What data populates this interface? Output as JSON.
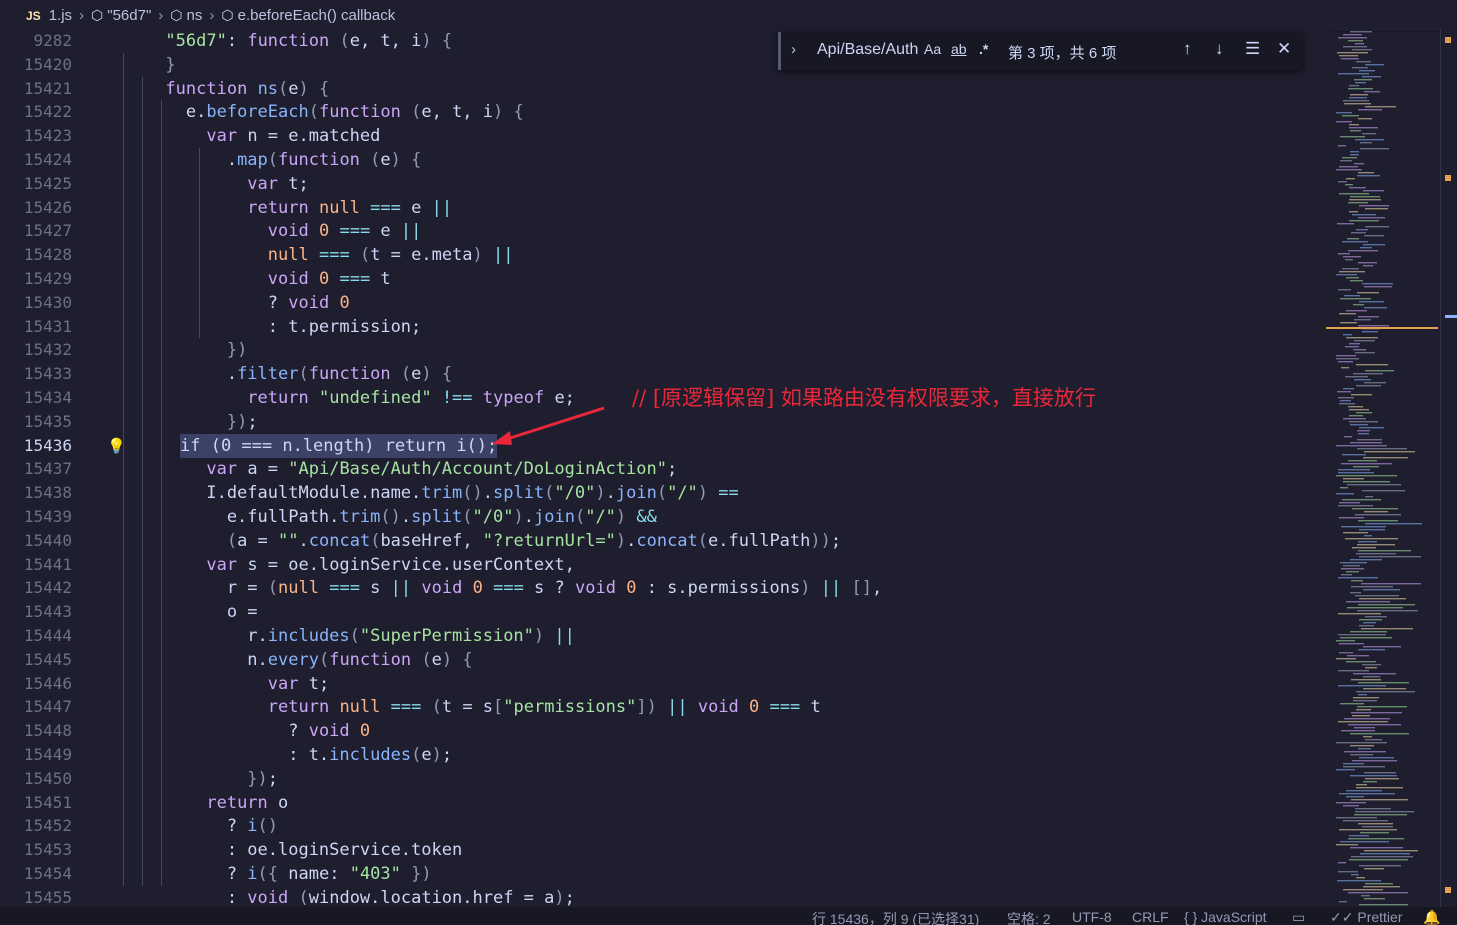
{
  "breadcrumb": {
    "lang_badge": "JS",
    "file": "1.js",
    "items": [
      "\"56d7\"",
      "ns",
      "e.beforeEach() callback"
    ]
  },
  "find_widget": {
    "query": "Api/Base/Auth",
    "match_case_label": "Aa",
    "whole_word_label": "ab",
    "regex_label": ".*",
    "result_text": "第 3 项，共 6 项"
  },
  "annotation": {
    "text": "// [原逻辑保留] 如果路由没有权限要求，直接放行",
    "color": "#e8283a"
  },
  "editor": {
    "current_line": "15436",
    "lines": [
      {
        "n": "9282",
        "sticky": true
      },
      {
        "n": "15420"
      },
      {
        "n": "15421"
      },
      {
        "n": "15422"
      },
      {
        "n": "15423"
      },
      {
        "n": "15424"
      },
      {
        "n": "15425"
      },
      {
        "n": "15426"
      },
      {
        "n": "15427"
      },
      {
        "n": "15428"
      },
      {
        "n": "15429"
      },
      {
        "n": "15430"
      },
      {
        "n": "15431"
      },
      {
        "n": "15432"
      },
      {
        "n": "15433"
      },
      {
        "n": "15434"
      },
      {
        "n": "15435"
      },
      {
        "n": "15436"
      },
      {
        "n": "15437"
      },
      {
        "n": "15438"
      },
      {
        "n": "15439"
      },
      {
        "n": "15440"
      },
      {
        "n": "15441"
      },
      {
        "n": "15442"
      },
      {
        "n": "15443"
      },
      {
        "n": "15444"
      },
      {
        "n": "15445"
      },
      {
        "n": "15446"
      },
      {
        "n": "15447"
      },
      {
        "n": "15448"
      },
      {
        "n": "15449"
      },
      {
        "n": "15450"
      },
      {
        "n": "15451"
      },
      {
        "n": "15452"
      },
      {
        "n": "15453"
      },
      {
        "n": "15454"
      },
      {
        "n": "15455"
      }
    ],
    "code": [
      [
        [
          "      ",
          ""
        ],
        [
          "\"56d7\"",
          "s"
        ],
        [
          ": ",
          ""
        ],
        [
          "function",
          "k"
        ],
        [
          " (e, t, i) ",
          ""
        ],
        [
          "{",
          "p"
        ]
      ],
      [
        [
          "      ",
          ""
        ],
        [
          "}",
          "f"
        ]
      ],
      [
        [
          "      ",
          ""
        ],
        [
          "function",
          "k"
        ],
        [
          " ",
          ""
        ],
        [
          "ns",
          "f"
        ],
        [
          "(e) ",
          ""
        ],
        [
          "{",
          "p"
        ]
      ],
      [
        [
          "        e.",
          ""
        ],
        [
          "beforeEach",
          "f"
        ],
        [
          "(",
          ""
        ],
        [
          "function",
          "k"
        ],
        [
          " (e, t, i) ",
          ""
        ],
        [
          "{",
          "p"
        ]
      ]
    ],
    "code_text": [
      "      \"56d7\": function (e, t, i) {",
      "      }",
      "      function ns(e) {",
      "        e.beforeEach(function (e, t, i) {",
      "          var n = e.matched",
      "            .map(function (e) {",
      "              var t;",
      "              return null === e ||",
      "                void 0 === e ||",
      "                null === (t = e.meta) ||",
      "                void 0 === t",
      "                ? void 0",
      "                : t.permission;",
      "            })",
      "            .filter(function (e) {",
      "              return \"undefined\" !== typeof e;",
      "            });",
      "          if (0 === n.length) return i();",
      "          var a = \"Api/Base/Auth/Account/DoLoginAction\";",
      "          I.defaultModule.name.trim().split(\"/0\").join(\"/\") ==",
      "            e.fullPath.trim().split(\"/0\").join(\"/\") &&",
      "            (a = \"\".concat(baseHref, \"?returnUrl=\").concat(e.fullPath));",
      "          var s = oe.loginService.userContext,",
      "            r = (null === s || void 0 === s ? void 0 : s.permissions) || [],",
      "            o =",
      "              r.includes(\"SuperPermission\") ||",
      "              n.every(function (e) {",
      "                var t;",
      "                return null === (t = s[\"permissions\"]) || void 0 === t",
      "                  ? void 0",
      "                  : t.includes(e);",
      "              });",
      "          return o",
      "            ? i()",
      "            : oe.loginService.token",
      "            ? i({ name: \"403\" })",
      "            : void (window.location.href = a);"
    ]
  },
  "status_bar": {
    "position": "行 15436，列 9 (已选择31)",
    "indent": "空格: 2",
    "encoding": "UTF-8",
    "eol": "CRLF",
    "language": "{ } JavaScript",
    "formatter": "✓✓ Prettier"
  }
}
